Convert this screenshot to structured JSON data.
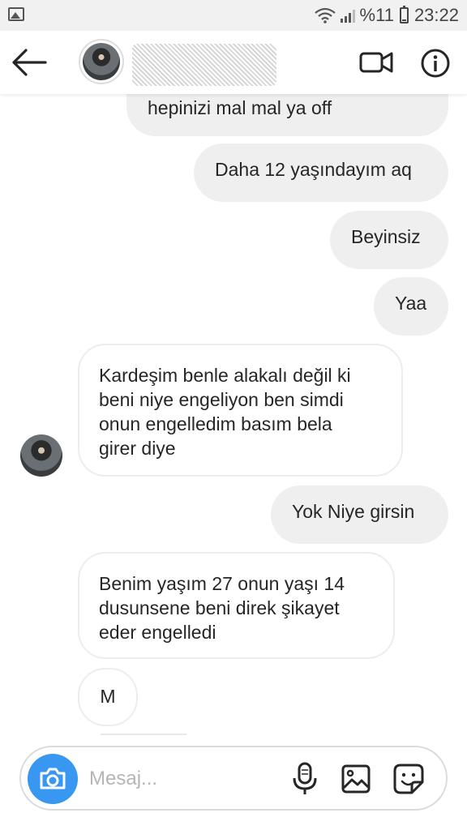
{
  "status_bar": {
    "battery_percent": "%11",
    "time": "23:22"
  },
  "header": {
    "contact_name": "",
    "icons": {
      "back": "arrow-left-icon",
      "video": "video-call-icon",
      "info": "info-icon"
    }
  },
  "messages": [
    {
      "side": "sent",
      "text": "hepinizi mal mal ya off"
    },
    {
      "side": "sent",
      "text": "Daha 12 yaşındayım aq"
    },
    {
      "side": "sent",
      "text": "Beyinsiz"
    },
    {
      "side": "sent",
      "text": "Yaa"
    },
    {
      "side": "received",
      "lines": [
        "Kardeşim benle alakalı değil ki",
        "beni niye engeliyon ben simdi",
        "onun engelledim basım bela",
        "girer diye"
      ]
    },
    {
      "side": "sent",
      "text": "Yok Niye girsin"
    },
    {
      "side": "received",
      "lines": [
        "Benim yaşım 27 onun yaşı 14",
        "dusunsene beni direk şikayet",
        "eder engelledi"
      ]
    },
    {
      "side": "received",
      "text": "M"
    }
  ],
  "composer": {
    "placeholder": "Mesaj...",
    "accent_color": "#3897f0",
    "icons": [
      "camera-icon",
      "microphone-icon",
      "gallery-icon",
      "sticker-icon"
    ]
  },
  "colors": {
    "sent_bubble": "#efefef",
    "received_border": "#ededed",
    "text": "#262626"
  }
}
